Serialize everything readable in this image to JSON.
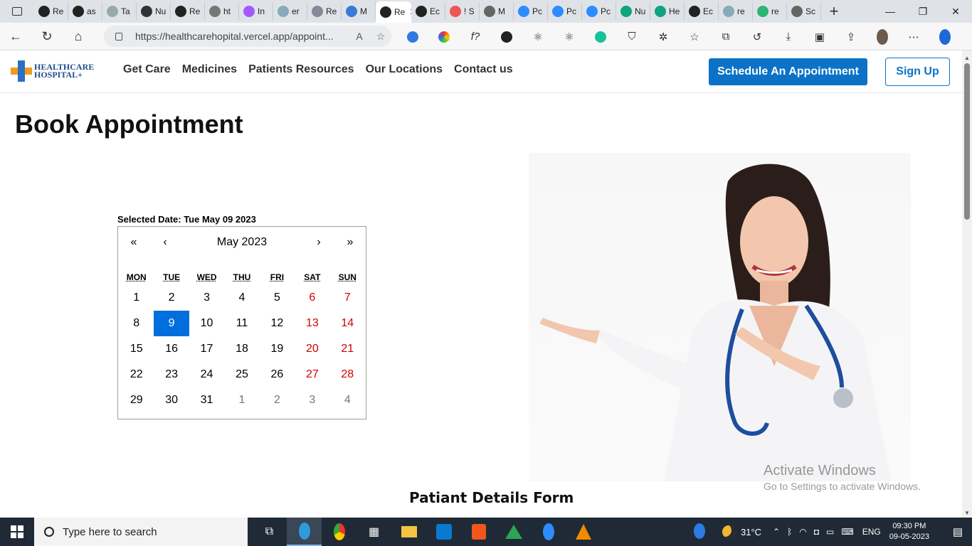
{
  "browser": {
    "tabs": [
      {
        "label": "Re",
        "icon": "react-icon",
        "color": "#222"
      },
      {
        "label": "as",
        "icon": "github-icon",
        "color": "#222"
      },
      {
        "label": "Ta",
        "icon": "chatgpt-icon",
        "color": "#9aa"
      },
      {
        "label": "Nu",
        "icon": "app-icon",
        "color": "#333"
      },
      {
        "label": "Re",
        "icon": "react-icon",
        "color": "#222"
      },
      {
        "label": "ht",
        "icon": "loading-icon",
        "color": "#777"
      },
      {
        "label": "In",
        "icon": "figma-icon",
        "color": "#a259ff"
      },
      {
        "label": "er",
        "icon": "search-icon",
        "color": "#8ab"
      },
      {
        "label": "Re",
        "icon": "stack-icon",
        "color": "#889"
      },
      {
        "label": "M",
        "icon": "vscode-icon",
        "color": "#3a7bd5"
      },
      {
        "label": "Re",
        "icon": "react-icon",
        "color": "#222",
        "active": true
      },
      {
        "label": "Ec",
        "icon": "github-icon",
        "color": "#222"
      },
      {
        "label": "! S",
        "icon": "figma-icon",
        "color": "#e55"
      },
      {
        "label": "M",
        "icon": "page-icon",
        "color": "#666"
      },
      {
        "label": "Pc",
        "icon": "zoom-icon",
        "color": "#2d8cff"
      },
      {
        "label": "Pc",
        "icon": "zoom-icon",
        "color": "#2d8cff"
      },
      {
        "label": "Pc",
        "icon": "zoom-icon",
        "color": "#2d8cff"
      },
      {
        "label": "Nu",
        "icon": "chatgpt-icon",
        "color": "#10a37f"
      },
      {
        "label": "He",
        "icon": "chatgpt-icon",
        "color": "#10a37f"
      },
      {
        "label": "Ec",
        "icon": "github-icon",
        "color": "#222"
      },
      {
        "label": "re",
        "icon": "search-icon",
        "color": "#8ab"
      },
      {
        "label": "re",
        "icon": "grid-icon",
        "color": "#2bb673"
      },
      {
        "label": "Sc",
        "icon": "page-icon",
        "color": "#666"
      }
    ],
    "url": "https://healthcarehopital.vercel.app/appoint..."
  },
  "site": {
    "logo_line1": "HEALTHCARE",
    "logo_line2": "HOSPITAL+",
    "nav": [
      "Get Care",
      "Medicines",
      "Patients Resources",
      "Our Locations",
      "Contact us"
    ],
    "appointment_button": "Schedule An Appointment",
    "signup_button": "Sign Up"
  },
  "main": {
    "title": "Book Appointment",
    "selected_date": "Selected Date: Tue May 09 2023",
    "form_title": "Patiant Details Form"
  },
  "calendar": {
    "month_label": "May 2023",
    "prev2": "«",
    "prev": "‹",
    "next": "›",
    "next2": "»",
    "weekdays": [
      "MON",
      "TUE",
      "WED",
      "THU",
      "FRI",
      "SAT",
      "SUN"
    ],
    "days": [
      "1",
      "2",
      "3",
      "4",
      "5",
      "6",
      "7",
      "8",
      "9",
      "10",
      "11",
      "12",
      "13",
      "14",
      "15",
      "16",
      "17",
      "18",
      "19",
      "20",
      "21",
      "22",
      "23",
      "24",
      "25",
      "26",
      "27",
      "28",
      "29",
      "30",
      "31",
      "1",
      "2",
      "3",
      "4"
    ],
    "selected_index": 8,
    "neighbor_from": 31,
    "colors": {
      "selected": "#006edc",
      "weekend": "#d10000",
      "neighbor": "#757575"
    }
  },
  "watermark": {
    "line1": "Activate Windows",
    "line2": "Go to Settings to activate Windows."
  },
  "taskbar": {
    "search_placeholder": "Type here to search",
    "temperature": "31°C",
    "language": "ENG",
    "time": "09:30 PM",
    "date": "09-05-2023"
  }
}
